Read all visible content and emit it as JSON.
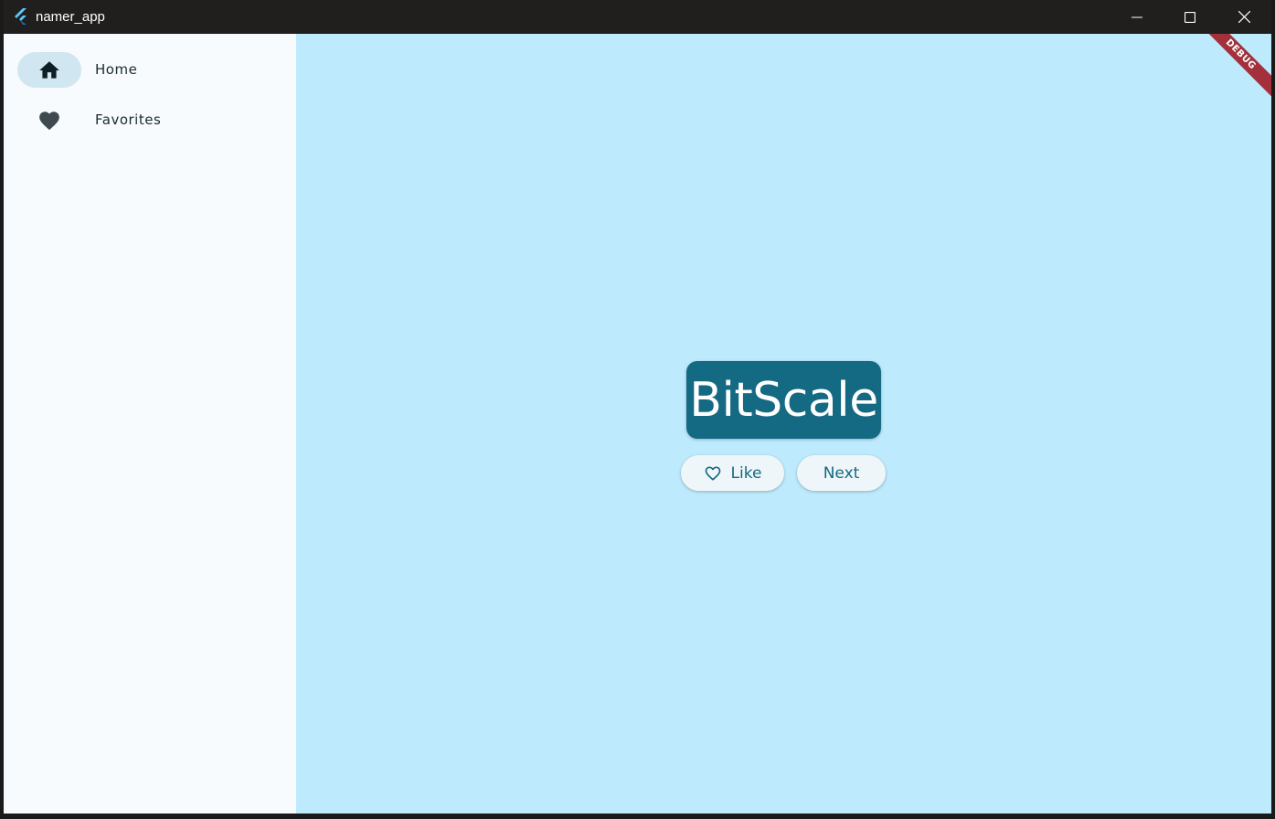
{
  "window": {
    "title": "namer_app"
  },
  "sidebar": {
    "items": [
      {
        "label": "Home",
        "icon": "home-icon",
        "selected": true
      },
      {
        "label": "Favorites",
        "icon": "heart-icon",
        "selected": false
      }
    ]
  },
  "debug_banner": {
    "label": "DEBUG"
  },
  "main": {
    "word": "BitScale",
    "like_label": "Like",
    "next_label": "Next"
  },
  "colors": {
    "background": "#bdeafc",
    "card": "#146983",
    "sidebar": "#f7fbfd",
    "selected_pill": "#d0e6f0",
    "debug": "#a3303a"
  }
}
